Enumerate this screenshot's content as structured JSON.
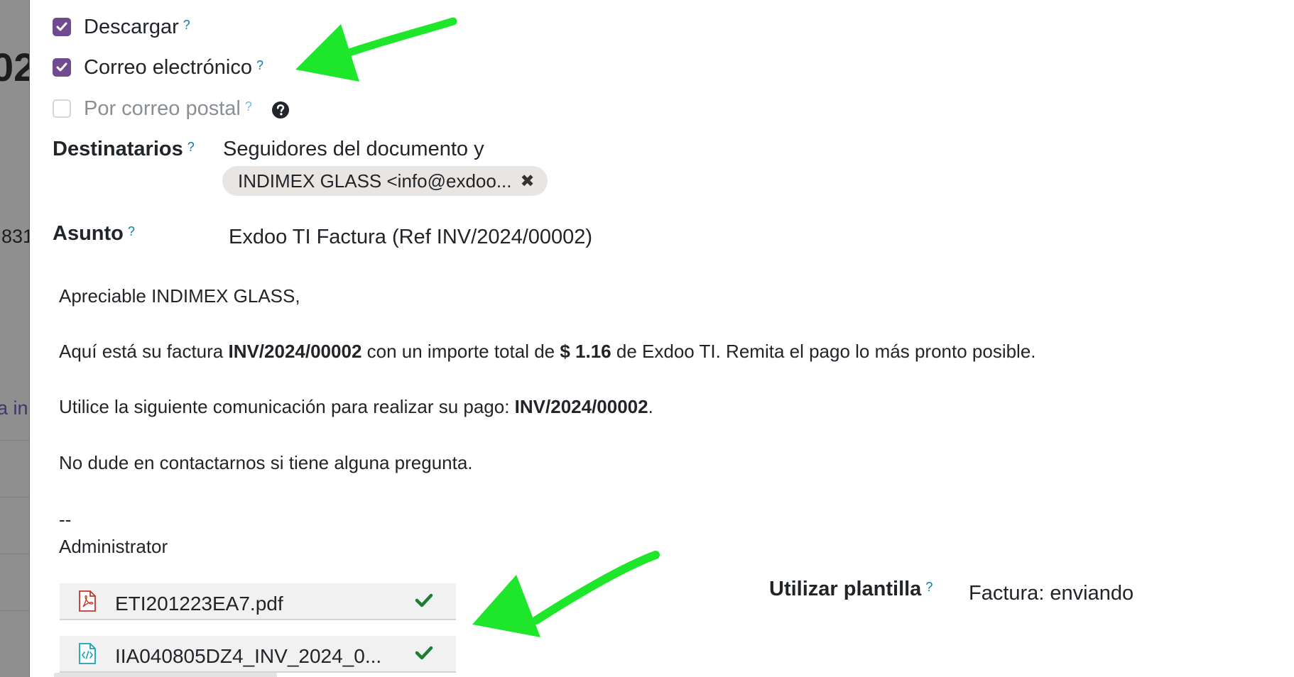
{
  "background_page": {
    "fragment_1": "02",
    "fragment_2": "831",
    "fragment_3": "a in"
  },
  "options": {
    "download": {
      "label": "Descargar",
      "help": "?",
      "checked": true
    },
    "email": {
      "label": "Correo electrónico",
      "help": "?",
      "checked": true
    },
    "post": {
      "label": "Por correo postal",
      "help": "?",
      "checked": false
    }
  },
  "recipients": {
    "label": "Destinatarios",
    "help": "?",
    "followers_text": "Seguidores del documento y",
    "tag": "INDIMEX GLASS <info@exdoo...",
    "tag_remove": "✖"
  },
  "subject": {
    "label": "Asunto",
    "help": "?",
    "value": "Exdoo TI Factura (Ref INV/2024/00002)"
  },
  "body": {
    "greeting": "Apreciable INDIMEX GLASS,",
    "p1_a": "Aquí está su factura ",
    "p1_invoice": "INV/2024/00002",
    "p1_b": " con un importe total de ",
    "p1_amount": "$ 1.16",
    "p1_c": " de Exdoo TI. Remita el pago lo más pronto posible.",
    "p2_a": "Utilice la siguiente comunicación para realizar su pago: ",
    "p2_ref": "INV/2024/00002",
    "p2_b": ".",
    "p3": "No dude en contactarnos si tiene alguna pregunta.",
    "sig_dash": "--",
    "signature": "Administrator"
  },
  "attachments": [
    {
      "name": "ETI201223EA7.pdf",
      "icon": "pdf-file-icon"
    },
    {
      "name": "IIA040805DZ4_INV_2024_0...",
      "icon": "xml-file-icon"
    }
  ],
  "template": {
    "label": "Utilizar plantilla",
    "help": "?",
    "value": "Factura: enviando"
  },
  "colors": {
    "checkbox_checked": "#714b8f",
    "help_marker": "#0a7ea4",
    "arrow": "#1ee62a",
    "tag_bg": "#e9e5e3",
    "success_check": "#1e7b34"
  }
}
